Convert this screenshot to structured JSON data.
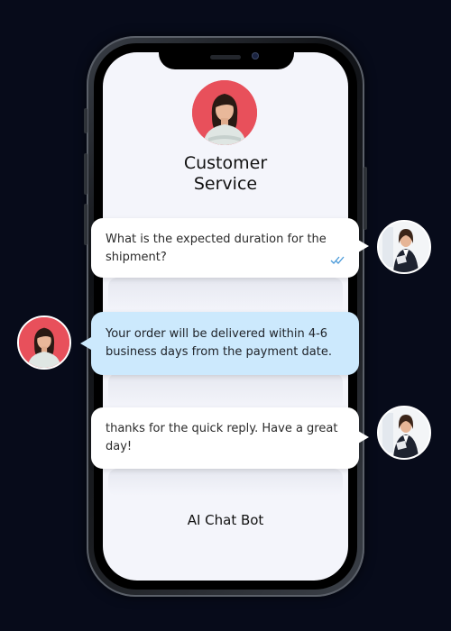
{
  "chat_header": {
    "title_line1": "Customer",
    "title_line2": "Service"
  },
  "messages": [
    {
      "sender": "customer",
      "text": "What is the expected duration for the shipment?",
      "status_icon": "double-check-icon"
    },
    {
      "sender": "agent",
      "text": "Your order will be delivered within 4-6 business days from the payment date."
    },
    {
      "sender": "customer",
      "text": "thanks for the quick reply. Have a great day!"
    }
  ],
  "footer": {
    "label": "AI Chat Bot"
  },
  "colors": {
    "background": "#070b1a",
    "screen": "#f4f5fb",
    "agent_bubble": "#cce9fd",
    "customer_bubble": "#ffffff",
    "avatar_accent": "#e8505b",
    "read_tick": "#4a9ad9"
  }
}
